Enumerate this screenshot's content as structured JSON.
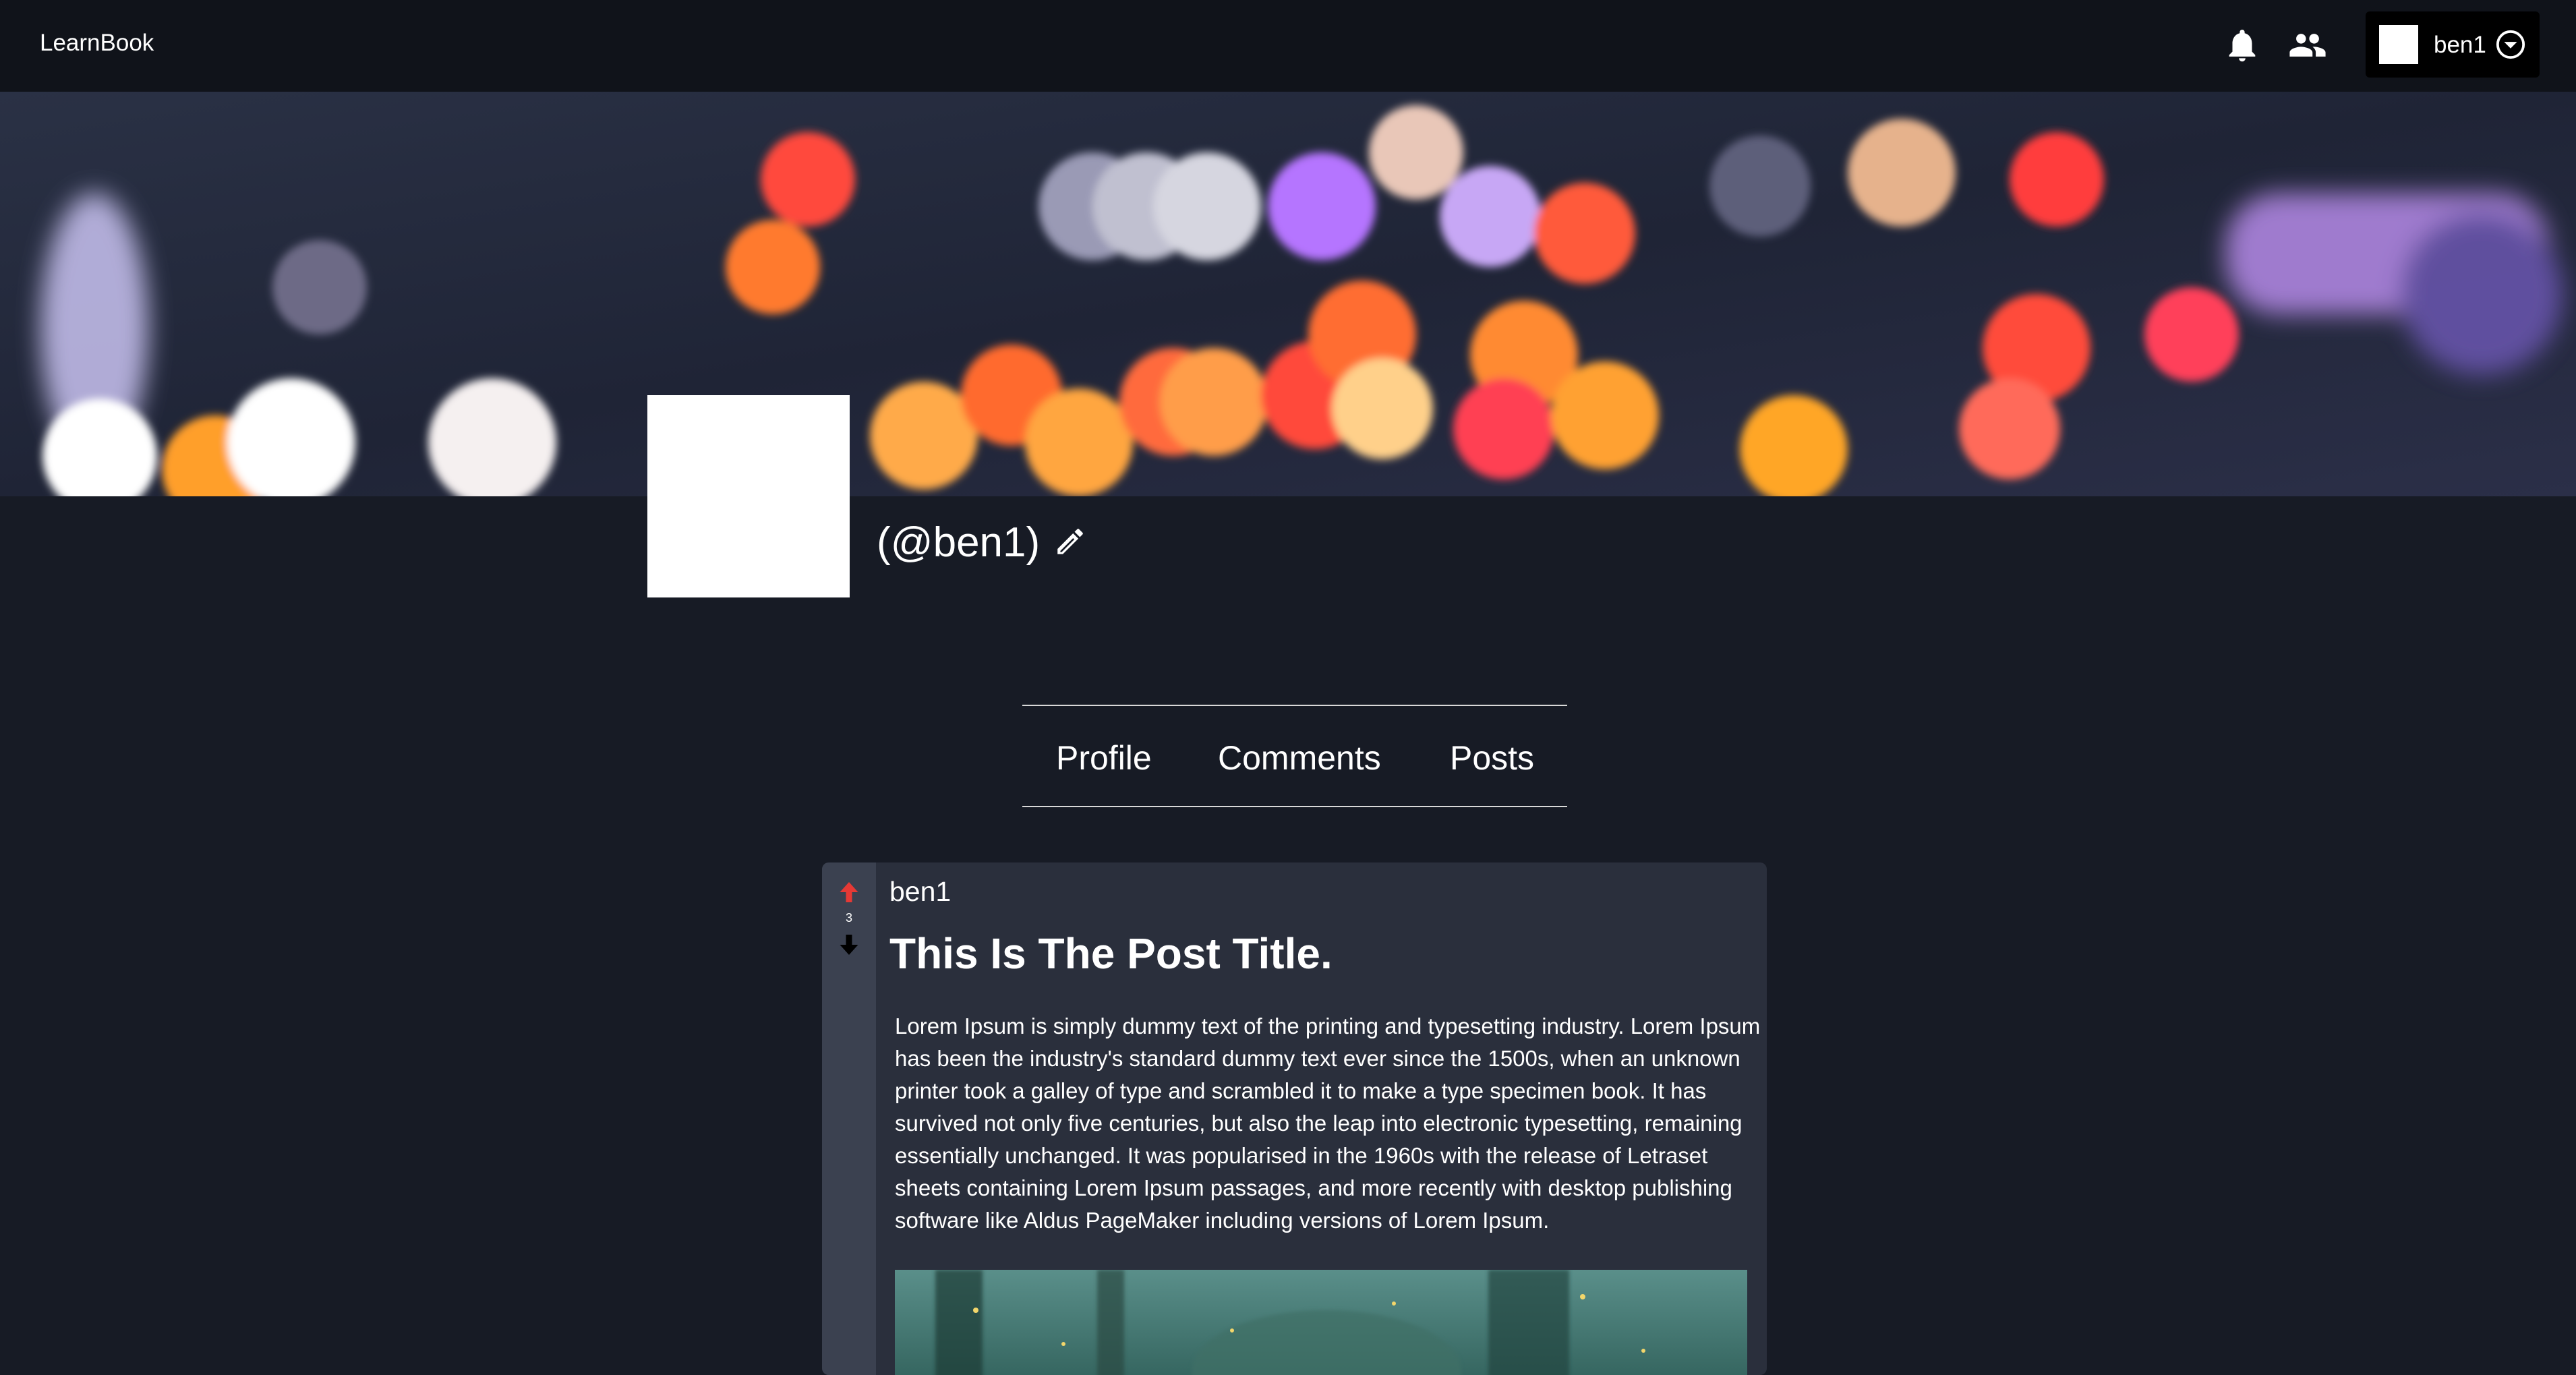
{
  "header": {
    "brand": "LearnBook",
    "username": "ben1",
    "icons": [
      "bell-icon",
      "people-icon",
      "chevron-down-circle-icon"
    ]
  },
  "profile": {
    "handle": "(@ben1)"
  },
  "tabs": [
    {
      "label": "Profile"
    },
    {
      "label": "Comments"
    },
    {
      "label": "Posts"
    }
  ],
  "post": {
    "votes": "3",
    "author": "ben1",
    "title": "This Is The Post Title.",
    "body": "Lorem Ipsum is simply dummy text of the printing and typesetting industry. Lorem Ipsum has been the industry's standard dummy text ever since the 1500s, when an unknown printer took a galley of type and scrambled it to make a type specimen book. It has survived not only five centuries, but also the leap into electronic typesetting, remaining essentially unchanged. It was popularised in the 1960s with the release of Letraset sheets containing Lorem Ipsum passages, and more recently with desktop publishing software like Aldus PageMaker including versions of Lorem Ipsum."
  },
  "colors": {
    "background": "#171b25",
    "topbar": "#10131a",
    "card": "#2a2f3c",
    "vote_column": "#3b4150",
    "upvote": "#e53935",
    "downvote": "#000000"
  }
}
